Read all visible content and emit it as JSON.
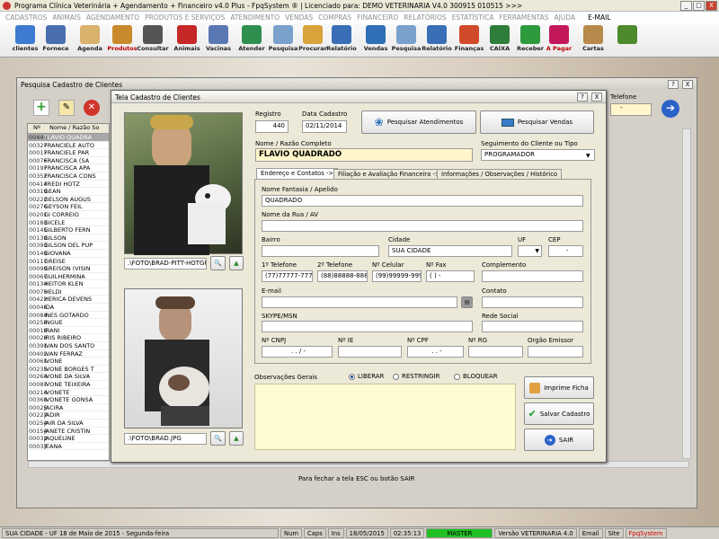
{
  "app": {
    "title": "Programa Clínica Veterinária + Agendamento + Financeiro v4.0 Plus - FpqSystem ® | Licenciado para: DEMO VETERINARIA V4.0 300915 010515 >>>",
    "window_buttons": [
      "_",
      "□",
      "X"
    ]
  },
  "menu": [
    "CADASTROS",
    "ANIMAIS",
    "AGENDAMENTO",
    "PRODUTOS E SERVIÇOS",
    "ATENDIMENTO",
    "VENDAS",
    "COMPRAS",
    "FINANCEIRO",
    "RELATÓRIOS",
    "ESTATÍSTICA",
    "FERRAMENTAS",
    "AJUDA",
    "E-MAIL"
  ],
  "toolbar": [
    {
      "label": "clientes",
      "color": "#3c7bd1"
    },
    {
      "label": "Fornece",
      "color": "#4a6fb0"
    },
    {
      "label": "Agenda",
      "color": "#d9b26b"
    },
    {
      "label": "Produtos",
      "color": "#c98a2c",
      "red": true
    },
    {
      "label": "Consultar",
      "color": "#555555"
    },
    {
      "label": "Animais",
      "color": "#c62828"
    },
    {
      "label": "Vacinas",
      "color": "#5a78b3"
    },
    {
      "label": "Atender",
      "color": "#2f8f4f"
    },
    {
      "label": "Pesquisa",
      "color": "#7aa0cc"
    },
    {
      "label": "Procurar",
      "color": "#d9a23a"
    },
    {
      "label": "Relatório",
      "color": "#3a6fb8"
    },
    {
      "label": "Vendas",
      "color": "#2e6fb5"
    },
    {
      "label": "Pesquisa",
      "color": "#7aa0cc"
    },
    {
      "label": "Relatório",
      "color": "#3a6fb8"
    },
    {
      "label": "Finanças",
      "color": "#d14a2a"
    },
    {
      "label": "CAIXA",
      "color": "#2f7d3a"
    },
    {
      "label": "Receber",
      "color": "#2e9a3e"
    },
    {
      "label": "A Pagar",
      "color": "#c2185b",
      "red": true
    },
    {
      "label": "Cartas",
      "color": "#b7894a"
    },
    {
      "label": "",
      "color": "#4c8a2c"
    }
  ],
  "back_window": {
    "title": "Pesquisa Cadastro de Clientes",
    "col_no": "Nº",
    "col_name": "Nome / Razão So",
    "telefone_label": "Telefone",
    "close_hint": "Para fechar a tela ESC ou botão SAIR",
    "rows": [
      [
        "00440",
        "FLAVIO QUADRA"
      ],
      [
        "00327",
        "FRANCIELE AUTO"
      ],
      [
        "00017",
        "FRANCIELE PAR"
      ],
      [
        "00076",
        "FRANCISCA (SA"
      ],
      [
        "00197",
        "FRANCISCA APA"
      ],
      [
        "00352",
        "FRANCISCA CONS"
      ],
      [
        "00414",
        "FREDI HOTZ"
      ],
      [
        "00319",
        "GEAN"
      ],
      [
        "00222",
        "GELSON AUGUS"
      ],
      [
        "00276",
        "GEYSON FEIL"
      ],
      [
        "00201",
        "GI CORREIO"
      ],
      [
        "00183",
        "GICELE"
      ],
      [
        "00145",
        "GILBERTO FERN"
      ],
      [
        "00138",
        "GILSON"
      ],
      [
        "00393",
        "GILSON DEL PUP"
      ],
      [
        "00149",
        "GIOVANA"
      ],
      [
        "00117",
        "GREISE"
      ],
      [
        "00099",
        "GREISON (VISIN"
      ],
      [
        "00067",
        "GUILHERMINA"
      ],
      [
        "00134",
        "HEITOR KLEN"
      ],
      [
        "00075",
        "HELDI"
      ],
      [
        "00422",
        "HERICA DEVENS"
      ],
      [
        "00046",
        "IDA"
      ],
      [
        "00084",
        "INES GOTARDO"
      ],
      [
        "00258",
        "INGUE"
      ],
      [
        "00018",
        "IRANI"
      ],
      [
        "00028",
        "IRIS RIBEIRO"
      ],
      [
        "00391",
        "IVAN DOS SANTO"
      ],
      [
        "00402",
        "IVAN FERRAZ"
      ],
      [
        "00061",
        "IVONE"
      ],
      [
        "00235",
        "IVONE BORGES T"
      ],
      [
        "00264",
        "IVONE DA SILVA"
      ],
      [
        "00087",
        "IVONE TEIXEIRA"
      ],
      [
        "00214",
        "IVONETE"
      ],
      [
        "00368",
        "IVONETE GONSA"
      ],
      [
        "00025",
        "JACIRA"
      ],
      [
        "00227",
        "JADIR"
      ],
      [
        "00254",
        "JAIR DA SILVA"
      ],
      [
        "00154",
        "JANETE CRISTIN"
      ],
      [
        "00032",
        "JAQUELINE"
      ],
      [
        "00037",
        "JEANA"
      ]
    ]
  },
  "dialog": {
    "title": "Tela Cadastro de Clientes",
    "registro_label": "Registro",
    "registro_value": "440",
    "data_label": "Data Cadastro",
    "data_value": "02/11/2014",
    "btn_atendimentos": "Pesquisar Atendimentos",
    "btn_vendas": "Pesquisar Vendas",
    "nome_label": "Nome / Razão Completo",
    "nome_value": "FLAVIO QUADRADO",
    "segmento_label": "Seguimento do Cliente ou Tipo",
    "segmento_value": "PROGRAMADOR",
    "photo1_path": ".\\FOTO\\BRAD-PITT-HOTGU",
    "photo2_path": ".\\FOTO\\BRAD.JPG",
    "tabs": [
      "Endereço e Contatos ->",
      "Filiação e Avaliação Financeira ->",
      "Informações / Observações / Histórico"
    ],
    "fields": {
      "fantasia_label": "Nome Fantasia / Apelido",
      "fantasia_value": "QUADRADO",
      "rua_label": "Nome da Rua / AV",
      "rua_value": "",
      "bairro_label": "Bairro",
      "bairro_value": "",
      "cidade_label": "Cidade",
      "cidade_value": "SUA CIDADE",
      "uf_label": "UF",
      "cep_label": "CEP",
      "cep_value": "-",
      "tel1_label": "1º Telefone",
      "tel1_value": "(77)77777-7777",
      "tel2_label": "2º Telefone",
      "tel2_value": "(88)88888-8888",
      "cel_label": "Nº Celular",
      "cel_value": "(99)99999-9999",
      "fax_label": "Nº Fax",
      "fax_value": "(  )    -",
      "complemento_label": "Complemento",
      "email_label": "E-mail",
      "contato_label": "Contato",
      "skype_label": "SKYPE/MSN",
      "rede_label": "Rede Social",
      "cnpj_label": "Nº CNPJ",
      "cnpj_value": ".    .    /    -",
      "ie_label": "Nº IE",
      "cpf_label": "Nº CPF",
      "cpf_value": ".    .    -",
      "rg_label": "Nº RG",
      "orgao_label": "Orgão Emissor"
    },
    "obs_label": "Observações Gerais",
    "radios": [
      "LIBERAR",
      "RESTRINGIR",
      "BLOQUEAR"
    ],
    "btn_imprime": "Imprime Ficha",
    "btn_salvar": "Salvar Cadastro",
    "btn_sair": "SAIR"
  },
  "status": {
    "left": "SUA CIDADE - UF 18 de Maio de 2015 - Segunda-feira",
    "num": "Num",
    "caps": "Caps",
    "ins": "Ins",
    "date": "18/05/2015",
    "time": "02:35:13",
    "mode": "MASTER",
    "version": "Versão VETERINARIA 4.0",
    "email": "Email",
    "site": "Site",
    "brand": "FpqSystem"
  }
}
